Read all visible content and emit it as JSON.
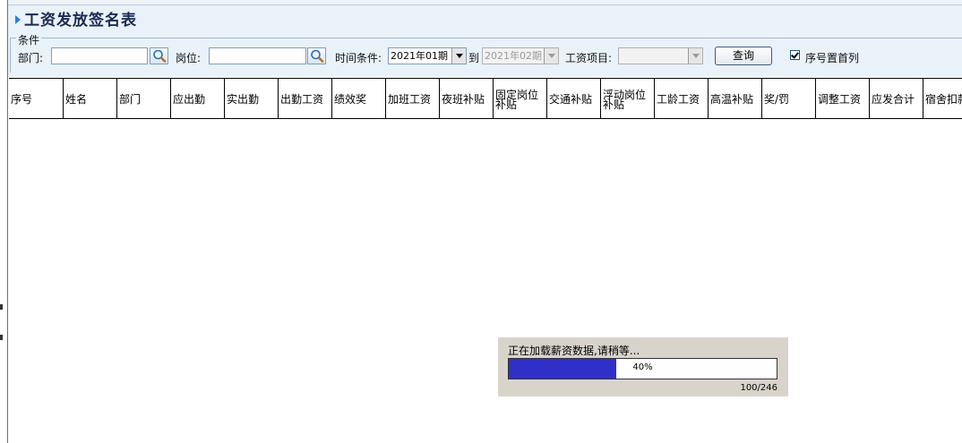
{
  "page_title": "工资发放签名表",
  "conditions": {
    "legend": "条件",
    "dept_label": "部门:",
    "dept_value": "",
    "post_label": "岗位:",
    "post_value": "",
    "time_label": "时间条件:",
    "time_from": "2021年01期",
    "to_label": "到",
    "time_to": "2021年02期",
    "item_label": "工资项目:",
    "item_value": "",
    "query_label": "查询",
    "seq_first_label": "序号置首列",
    "seq_first_checked": true
  },
  "table": {
    "columns": [
      "序号",
      "姓名",
      "部门",
      "应出勤",
      "实出勤",
      "出勤工资",
      "绩效奖",
      "加班工资",
      "夜班补贴",
      "固定岗位补贴",
      "交通补贴",
      "浮动岗位补贴",
      "工龄工资",
      "高温补贴",
      "奖/罚",
      "调整工资",
      "应发合计",
      "宿舍扣款"
    ]
  },
  "progress": {
    "message": "正在加载薪资数据,请稍等...",
    "percent_label": "40%",
    "fraction": 0.4,
    "count": "100/246"
  },
  "colors": {
    "header_bg": "#e9f1f9",
    "progress_fill": "#3030c8",
    "dialog_bg": "#d8d4cc"
  }
}
